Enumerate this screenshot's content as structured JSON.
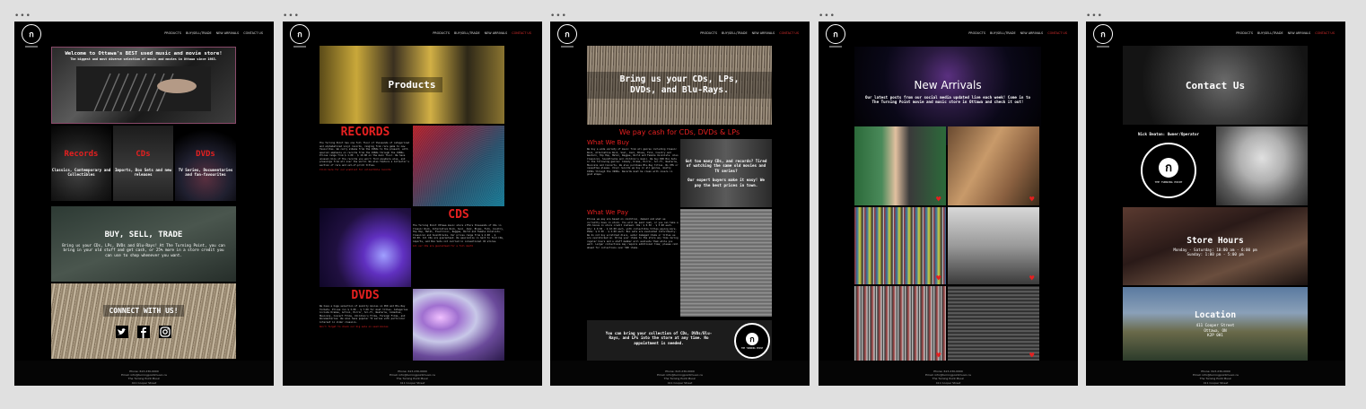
{
  "dots": "•••",
  "nav": {
    "logo_glyph": "ก",
    "links": [
      "PRODUCTS",
      "BUY/SELL/TRADE",
      "NEW ARRIVALS",
      "CONTACT US"
    ]
  },
  "footer": {
    "line1": "Phone: 613-230-0000",
    "line2": "Email: info@turningpointmusic.ca",
    "line3": "The Turning Point Music",
    "line4": "411 Cooper Street"
  },
  "colors": {
    "accent_red": "#e52020",
    "page_bg": "#000000",
    "board_bg": "#e0e0e0"
  },
  "home": {
    "hero_title": "Welcome to Ottawa's BEST used music and movie store!",
    "hero_sub": "The biggest and most diverse selection of music and movies in Ottawa since 1983.",
    "categories": [
      {
        "title": "Records",
        "desc": "Classics, Contemporary and Collectibles"
      },
      {
        "title": "CDs",
        "desc": "Imports, Box Sets and new releases"
      },
      {
        "title": "DVDs",
        "desc": "TV Series, Documentaries and fan-favourites"
      }
    ],
    "buy_title": "BUY, SELL, TRADE",
    "buy_text": "Bring us your CDs, LPs, DVDs and Blu-Rays! At The Turning Point, you can bring in your old stuff and get cash, or 25% more in a store credit you can use to shop whenever you want.",
    "connect_title": "CONNECT WITH US!",
    "social_icons": [
      "twitter-icon",
      "facebook-icon",
      "instagram-icon"
    ]
  },
  "products": {
    "hero_title": "Products",
    "records_title": "RECORDS",
    "records_text": "The Turning Point has one full floor of thousands of categorized and alphabetized vinyl records, ranging from rare gems to new favourites. We carry albums from the 1950s to the present, with special emphasis on records from the 1960s through the 1980s. Prices range from $ 1.00 - $ 10.00 on the main floor. We have unusual bins of the records you won't find anywhere else, and pressings from all over the world. We also feature a Collector's section of rare and out-of-print titles.",
    "records_link": "Click here for our wishlist for collectible records",
    "cds_title": "CDS",
    "cds_text": "The Turning Point Ottawa music store offers thousands of CDs in Classic Rock, Alternative Rock, Soul, Jazz, Blues, Folk, Country, Hip Hop, Metal, Electronic, Reggae, World and Female Vocalists. Classical and Soundtracks. Our prices range from $ 4.00 - $ 10.00. All CDs are guaranteed. We specialize in hard to find CDs, imports, and Box Sets not carried in conventional CD stores.",
    "cds_link": "All our CDs are guaranteed for a full month",
    "dvds_title": "DVDS",
    "dvds_text": "We have a huge selection of quality movies on DVD and Blu-Ray formats. Prices run $ 3.00 - $ 7.00 for most titles. Categories include Dramas, Action, Horror, Sci-Fi, Westerns, Comedies, Musicals, Concert Films, Children's Films, Foreign Films, and Documentaries. We also have popular TV series with particular interest in older classics.",
    "dvds_link": "Don't forget to check our big sale on used movies"
  },
  "buysell": {
    "hero_title": "Bring us your CDs, LPs, DVDs, and Blu-Rays.",
    "banner": "We pay cash for CDs, DVDs & LPs",
    "buy_heading": "What We Buy",
    "buy_text": "We buy a wide variety of music from all genres including Classic Rock, Alternative Rock, Soul, Jazz, Blues, Folk, Country and Western, Hip Hop, Metal, Reggae, World and Female Vocalists. Also Classical, Soundtracks and children's music. We buy DVD Box Sets in the following genres: Comedy, Drama, Horror, Sci-Fi, Westerns, Musicals and Concerts. We also purchase Blu-Ray titles. No VHS or cassettes please. Vinyl records we buy in all genres, mostly 1950s through the 1980s. Records must be clean with covers in good shape.",
    "pay_heading": "What We Pay",
    "pay_text": "Prices we pay are based on condition, demand and what we currently have in stock. You will be paid cash, or you can take a 25% bonus in store credit instead. CDs: $ 0.50 - $ 3.00 each. LPs: $ 0.50 - $ 10.00 each, with collectible titles paying more. DVDs: $ 0.50 - $ 2.00 each. Box sets are evaluated individually. We do not buy scratched discs, water damaged items or titles we are overstocked on. Bring your items to the store any time during regular hours and a staff member will evaluate them while you wait. Larger collections may require additional time; please call ahead for collections over 500 items.",
    "side_q": "Got too many CDs, and records? Tired of watching the same old movies and TV series?",
    "side_a": "Our expert buyers make it easy! We pay the best prices in town.",
    "bottom_text": "You can bring your collection of CDs, DVDs/Blu-Rays, and LPs into the store at any time. No appointment is needed.",
    "badge_caption": "THE TURNING POINT"
  },
  "arrivals": {
    "title": "New Arrivals",
    "text": "Our latest posts from our social media updated live each week! Come in to The Turning Point movie and music store in Ottawa and check it out!"
  },
  "contact": {
    "hero_title": "Contact Us",
    "owner": "Nick Beaton: Owner/Operator",
    "badge_caption": "THE TURNING POINT",
    "hours_title": "Store Hours",
    "hours_line1": "Monday - Saturday: 10:00 am - 6:00 pm",
    "hours_line2": "Sunday: 1:00 pm - 5:00 pm",
    "location_title": "Location",
    "addr1": "411 Cooper Street",
    "addr2": "Ottawa, ON",
    "addr3": "K2P 0H1"
  }
}
